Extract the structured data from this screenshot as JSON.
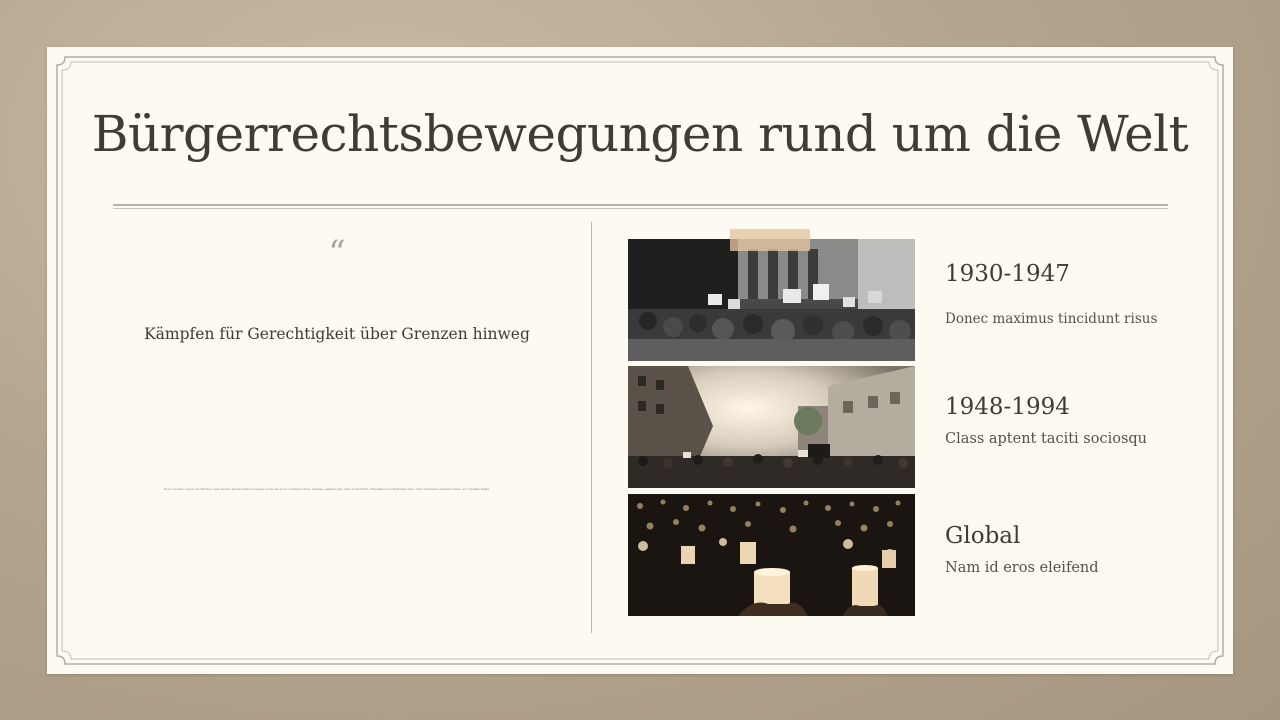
{
  "slide": {
    "title": "Bürgerrechtsbewegungen rund um die Welt"
  },
  "quote": {
    "mark": "“",
    "text": "Kämpfen für Gerechtigkeit über Grenzen hinweg",
    "fine_print": "Donec mollis, neque in efficitur, eget iaculis ipsum tellus id neque sociis ad et at conubia nostra. Aenean egestas quis urna a tincidunt. Phasellus in sollicitudin felis. Cras venenatis pretium tellus, et convallis ligula."
  },
  "timeline": [
    {
      "period": "1930-1947",
      "description": "Donec maximus tincidunt risus",
      "photo": "protest-crowd-signs-photo"
    },
    {
      "period": "1948-1994",
      "description": "Class aptent taciti sociosqu",
      "photo": "street-march-crowd-photo"
    },
    {
      "period": "Global",
      "description": "Nam id eros eleifend",
      "photo": "candlelight-vigil-photo"
    }
  ],
  "colors": {
    "background": "#b5a68f",
    "paper": "#fdfaf1",
    "text": "#3f3c35",
    "rule": "#b7b2a6"
  }
}
